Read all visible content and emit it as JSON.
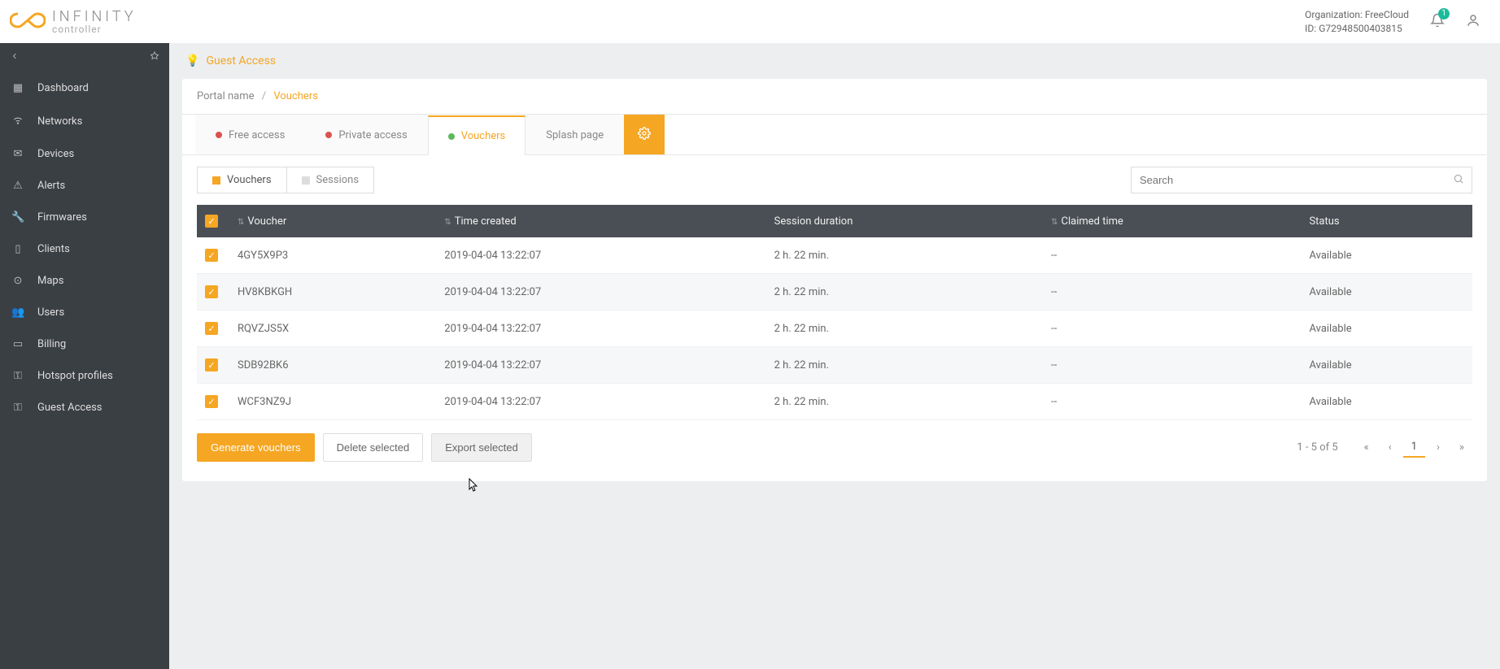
{
  "brand": {
    "top": "INFINITY",
    "bottom": "controller"
  },
  "header": {
    "org_label": "Organization: FreeCloud",
    "id_label": "ID: G72948500403815",
    "notif_count": "1"
  },
  "sidebar": {
    "items": [
      {
        "label": "Dashboard",
        "icon": "grid"
      },
      {
        "label": "Networks",
        "icon": "wifi"
      },
      {
        "label": "Devices",
        "icon": "inbox"
      },
      {
        "label": "Alerts",
        "icon": "warn"
      },
      {
        "label": "Firmwares",
        "icon": "wrench"
      },
      {
        "label": "Clients",
        "icon": "phone"
      },
      {
        "label": "Maps",
        "icon": "pin"
      },
      {
        "label": "Users",
        "icon": "users"
      },
      {
        "label": "Billing",
        "icon": "card"
      },
      {
        "label": "Hotspot profiles",
        "icon": "key"
      },
      {
        "label": "Guest Access",
        "icon": "key"
      }
    ]
  },
  "page": {
    "title": "Guest Access",
    "crumb_portal": "Portal name",
    "crumb_current": "Vouchers"
  },
  "tabs": {
    "free": "Free access",
    "private": "Private access",
    "vouchers": "Vouchers",
    "splash": "Splash page"
  },
  "subtabs": {
    "vouchers": "Vouchers",
    "sessions": "Sessions"
  },
  "search": {
    "placeholder": "Search"
  },
  "columns": {
    "voucher": "Voucher",
    "created": "Time created",
    "duration": "Session duration",
    "claimed": "Claimed time",
    "status": "Status"
  },
  "rows": [
    {
      "code": "4GY5X9P3",
      "created": "2019-04-04 13:22:07",
      "duration": "2 h. 22 min.",
      "claimed": "--",
      "status": "Available"
    },
    {
      "code": "HV8KBKGH",
      "created": "2019-04-04 13:22:07",
      "duration": "2 h. 22 min.",
      "claimed": "--",
      "status": "Available"
    },
    {
      "code": "RQVZJS5X",
      "created": "2019-04-04 13:22:07",
      "duration": "2 h. 22 min.",
      "claimed": "--",
      "status": "Available"
    },
    {
      "code": "SDB92BK6",
      "created": "2019-04-04 13:22:07",
      "duration": "2 h. 22 min.",
      "claimed": "--",
      "status": "Available"
    },
    {
      "code": "WCF3NZ9J",
      "created": "2019-04-04 13:22:07",
      "duration": "2 h. 22 min.",
      "claimed": "--",
      "status": "Available"
    }
  ],
  "actions": {
    "generate": "Generate vouchers",
    "delete": "Delete selected",
    "export": "Export selected"
  },
  "pagination": {
    "summary": "1 - 5 of 5",
    "first": "«",
    "prev": "‹",
    "page": "1",
    "next": "›",
    "last": "»"
  }
}
